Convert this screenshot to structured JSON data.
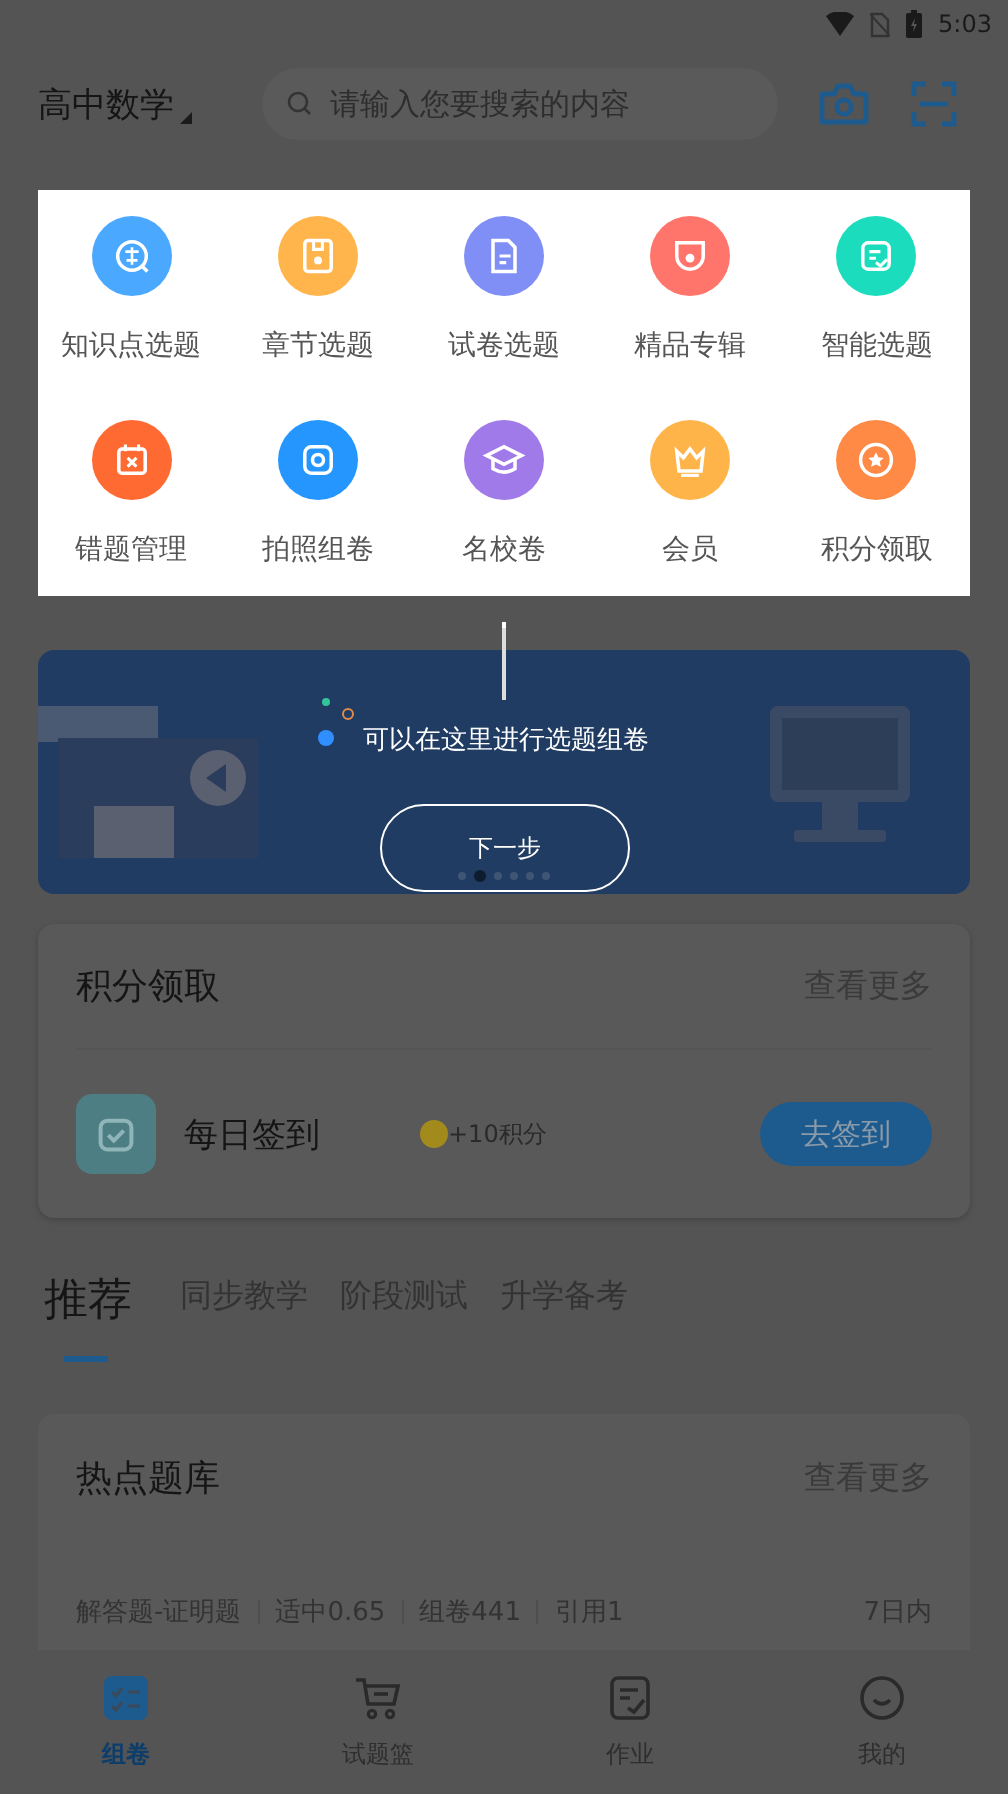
{
  "status_bar": {
    "time": "5:03"
  },
  "header": {
    "subject": "高中数学",
    "search": {
      "placeholder": "请输入您要搜索的内容"
    }
  },
  "shortcuts": [
    {
      "label": "知识点选题",
      "color": "#4aa8ff"
    },
    {
      "label": "章节选题",
      "color": "#ffb54c"
    },
    {
      "label": "试卷选题",
      "color": "#7f8ff5"
    },
    {
      "label": "精品专辑",
      "color": "#ff756b"
    },
    {
      "label": "智能选题",
      "color": "#1bdcbc"
    },
    {
      "label": "错题管理",
      "color": "#ff6a33"
    },
    {
      "label": "拍照组卷",
      "color": "#2696ff"
    },
    {
      "label": "名校卷",
      "color": "#a07ae8"
    },
    {
      "label": "会员",
      "color": "#ffb44a"
    },
    {
      "label": "积分领取",
      "color": "#ff8a45"
    }
  ],
  "guide": {
    "text": "可以在这里进行选题组卷",
    "button": "下一步"
  },
  "banner": {
    "dots": [
      {
        "selected": false
      },
      {
        "selected": true
      },
      {
        "selected": false
      },
      {
        "selected": false
      },
      {
        "selected": false
      },
      {
        "selected": false
      }
    ]
  },
  "points_card": {
    "title": "积分领取",
    "more": "查看更多",
    "task": {
      "name": "每日签到",
      "reward": "+10积分",
      "button": "去签到"
    }
  },
  "tabs": [
    {
      "label": "推荐",
      "selected": true
    },
    {
      "label": "同步教学",
      "selected": false
    },
    {
      "label": "阶段测试",
      "selected": false
    },
    {
      "label": "升学备考",
      "selected": false
    }
  ],
  "hot_card": {
    "title": "热点题库",
    "more": "查看更多",
    "meta": [
      "解答题-证明题",
      "适中0.65",
      "组卷441",
      "引用1"
    ],
    "time": "7日内"
  },
  "bottom_nav": [
    {
      "label": "组卷",
      "selected": true
    },
    {
      "label": "试题篮",
      "selected": false
    },
    {
      "label": "作业",
      "selected": false
    },
    {
      "label": "我的",
      "selected": false
    }
  ]
}
